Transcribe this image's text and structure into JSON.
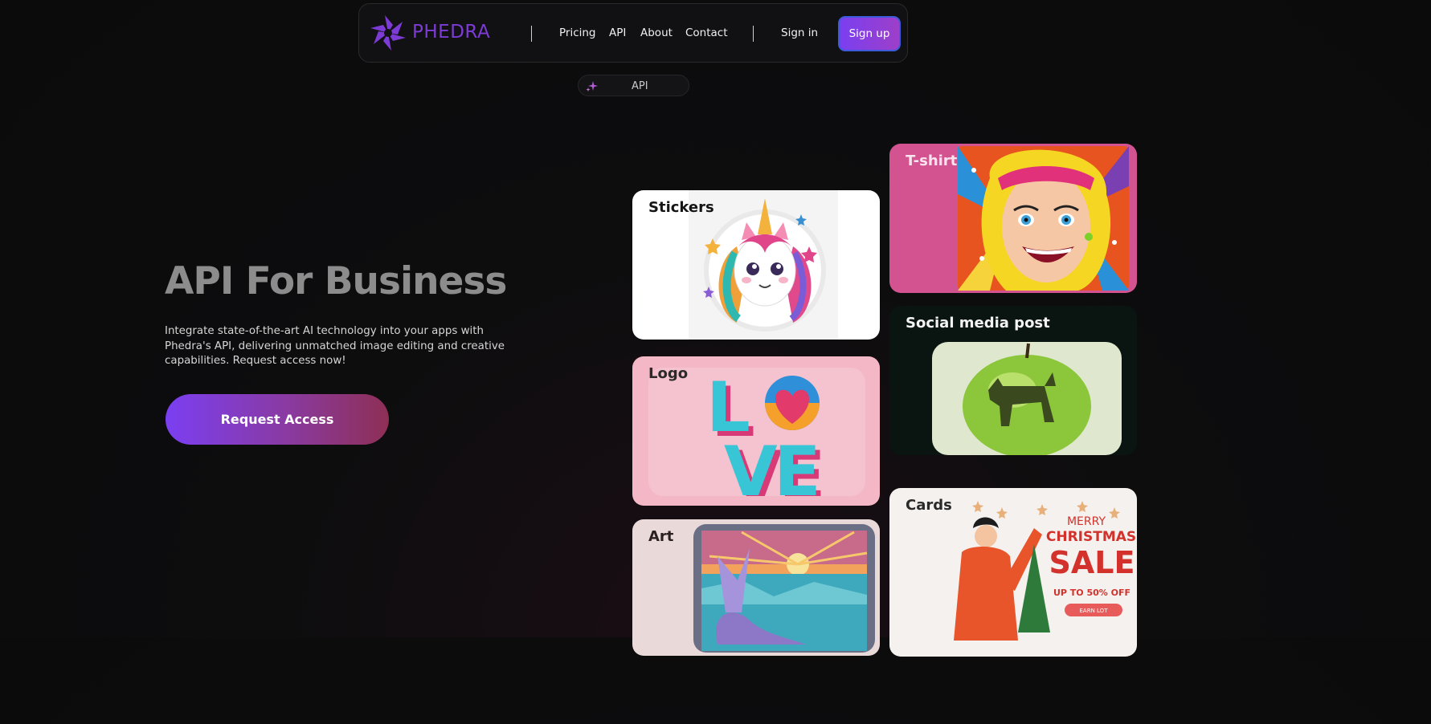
{
  "nav": {
    "brand": "PHEDRA",
    "links": [
      "Pricing",
      "API",
      "About",
      "Contact"
    ],
    "sign_in": "Sign in",
    "sign_up": "Sign up"
  },
  "pill": {
    "label": "API"
  },
  "hero": {
    "title": "API For Business",
    "subtitle": "Integrate state-of-the-art AI technology into your apps with Phedra's API, delivering unmatched image editing and creative capabilities. Request access now!",
    "cta": "Request Access"
  },
  "cards": {
    "stickers": "Stickers",
    "tshirt": "T-shirt",
    "logo": "Logo",
    "social": "Social media post",
    "art": "Art",
    "cards": "Cards"
  },
  "card_texts": {
    "merry": "MERRY",
    "christmas": "CHRISTMAS",
    "sale": "SALE",
    "off": "UP TO 50% OFF",
    "earn": "EARN LOT",
    "love_l": "L",
    "love_v": "V",
    "love_e": "E"
  },
  "colors": {
    "accent": "#7b3ff2",
    "brand": "#7d3bd6",
    "tshirt_bg": "#d2538f",
    "social_bg": "#0a1410",
    "logo_bg": "#f3b7c5"
  }
}
